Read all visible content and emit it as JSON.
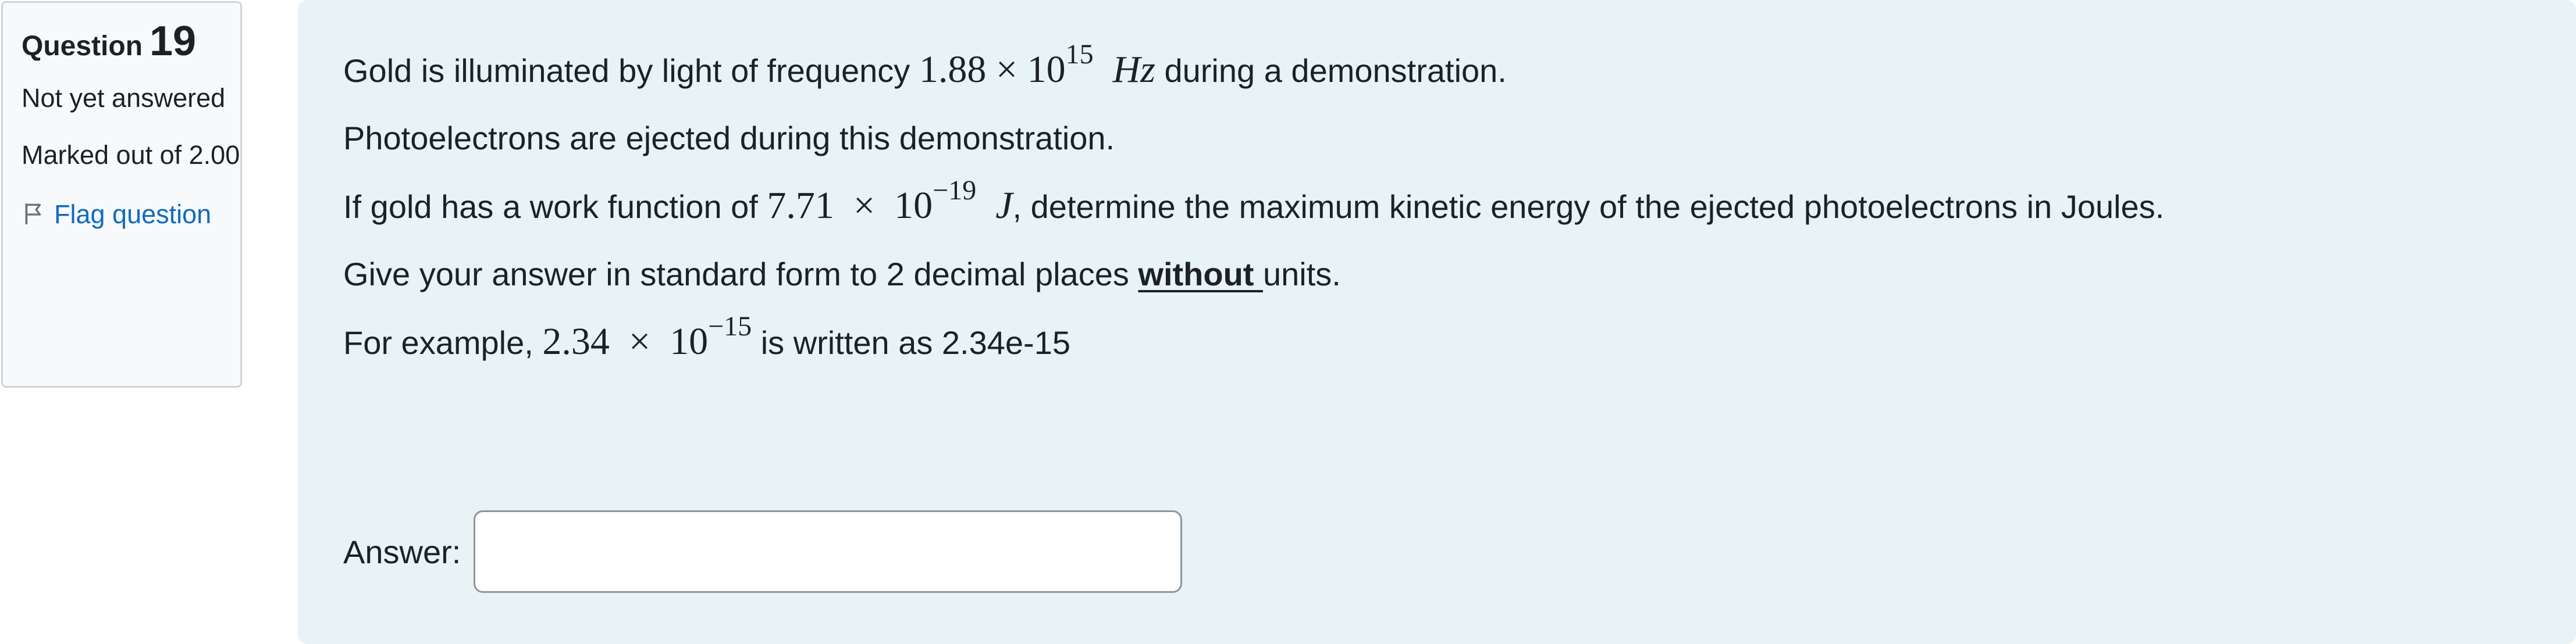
{
  "info": {
    "question_word": "Question",
    "question_number": "19",
    "state": "Not yet answered",
    "grade": "Marked out of 2.00",
    "flag_label": "Flag question",
    "flag_icon": "flag-icon"
  },
  "question": {
    "line1": {
      "before": "Gold is illuminated by light of frequency ",
      "mantissa": "1.88 × 10",
      "exponent": "15",
      "unit": "Hz",
      "after": " during a demonstration."
    },
    "line2": "Photoelectrons are ejected during this demonstration.",
    "line3": {
      "before": "If gold has a work function of ",
      "mantissa": "7.71  ×  10",
      "exponent": "−19",
      "unit": "J",
      "after": ", determine the maximum kinetic energy of the ejected photoelectrons in Joules."
    },
    "line4": {
      "before": "Give your answer in standard form to 2 decimal places ",
      "emphasis": "without ",
      "after": "units."
    },
    "line5": {
      "before": "For example, ",
      "mantissa": "2.34  ×  10",
      "exponent": "−15",
      "after": " is written as 2.34e-15"
    }
  },
  "answer": {
    "label": "Answer:",
    "value": ""
  }
}
